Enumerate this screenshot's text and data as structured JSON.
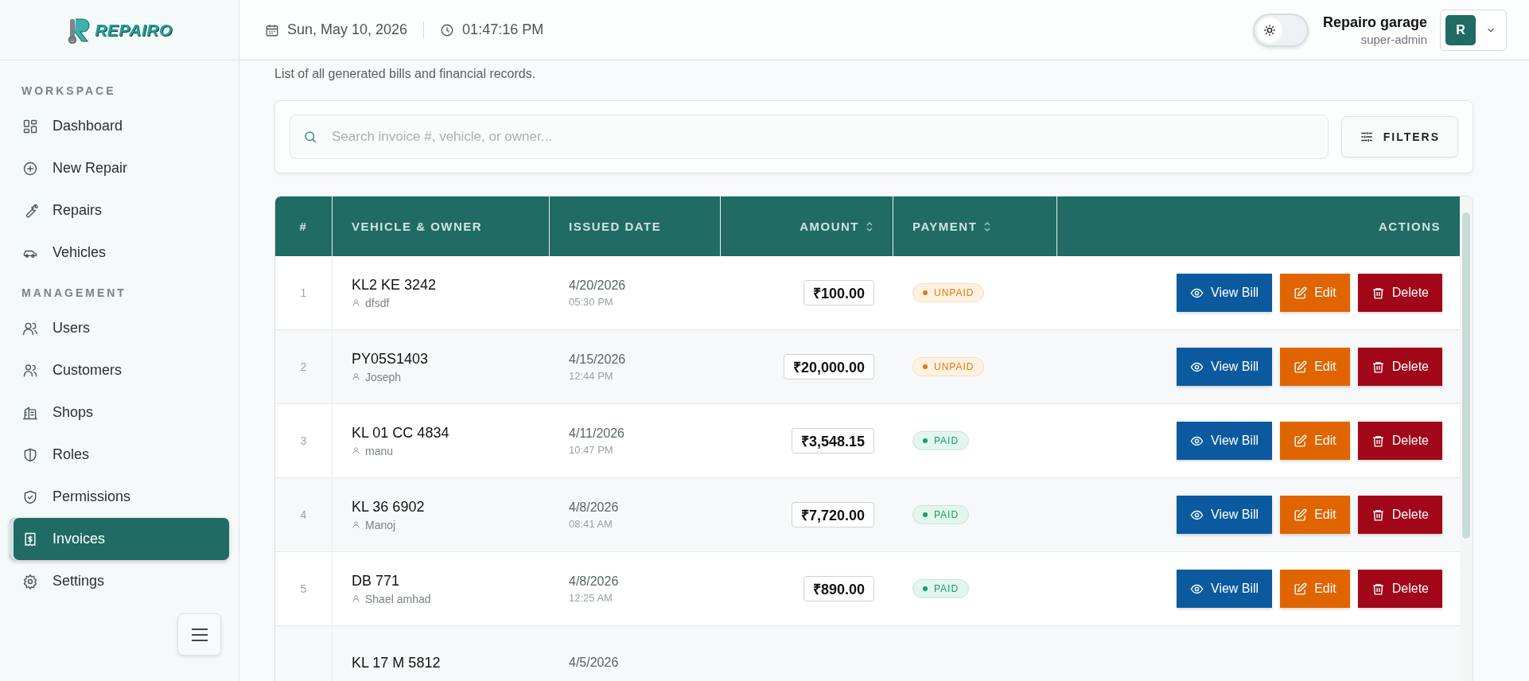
{
  "brand": {
    "name": "REPAIRO"
  },
  "header": {
    "date": "Sun, May 10, 2026",
    "time": "01:47:16 PM",
    "dark_mode": false,
    "user_name": "Repairo garage",
    "user_role": "super-admin",
    "avatar_initial": "R"
  },
  "sidebar": {
    "sections": [
      {
        "title": "WORKSPACE",
        "items": [
          {
            "label": "Dashboard",
            "selected": false
          },
          {
            "label": "New Repair",
            "selected": false
          },
          {
            "label": "Repairs",
            "selected": false
          },
          {
            "label": "Vehicles",
            "selected": false
          }
        ]
      },
      {
        "title": "MANAGEMENT",
        "items": [
          {
            "label": "Users",
            "selected": false
          },
          {
            "label": "Customers",
            "selected": false
          },
          {
            "label": "Shops",
            "selected": false
          },
          {
            "label": "Roles",
            "selected": false
          },
          {
            "label": "Permissions",
            "selected": false
          },
          {
            "label": "Invoices",
            "selected": true
          },
          {
            "label": "Settings",
            "selected": false
          }
        ]
      }
    ]
  },
  "page": {
    "subtitle": "List of all generated bills and financial records."
  },
  "search": {
    "placeholder": "Search invoice #, vehicle, or owner...",
    "filters_label": "FILTERS"
  },
  "table": {
    "columns": [
      {
        "label": "#",
        "sortable": false
      },
      {
        "label": "VEHICLE & OWNER",
        "sortable": false
      },
      {
        "label": "ISSUED DATE",
        "sortable": false
      },
      {
        "label": "AMOUNT",
        "sortable": true
      },
      {
        "label": "PAYMENT",
        "sortable": true
      },
      {
        "label": "ACTIONS",
        "sortable": false
      }
    ],
    "rows": [
      {
        "index": "1",
        "vehicle": "KL2 KE 3242",
        "owner": "dfsdf",
        "date": "4/20/2026",
        "time": "05:30 PM",
        "amount": "₹100.00",
        "payment": {
          "label": "UNPAID",
          "paid": false
        },
        "actions": [
          {
            "label": "View Bill",
            "kind": "view"
          },
          {
            "label": "Edit",
            "kind": "edit"
          },
          {
            "label": "Delete",
            "kind": "delete"
          }
        ]
      },
      {
        "index": "2",
        "vehicle": "PY05S1403",
        "owner": "Joseph",
        "date": "4/15/2026",
        "time": "12:44 PM",
        "amount": "₹20,000.00",
        "payment": {
          "label": "UNPAID",
          "paid": false
        },
        "actions": [
          {
            "label": "View Bill",
            "kind": "view"
          },
          {
            "label": "Edit",
            "kind": "edit"
          },
          {
            "label": "Delete",
            "kind": "delete"
          }
        ]
      },
      {
        "index": "3",
        "vehicle": "KL 01 CC 4834",
        "owner": "manu",
        "date": "4/11/2026",
        "time": "10:47 PM",
        "amount": "₹3,548.15",
        "payment": {
          "label": "PAID",
          "paid": true
        },
        "actions": [
          {
            "label": "View Bill",
            "kind": "view"
          },
          {
            "label": "Edit",
            "kind": "edit"
          },
          {
            "label": "Delete",
            "kind": "delete"
          }
        ]
      },
      {
        "index": "4",
        "vehicle": "KL 36 6902",
        "owner": "Manoj",
        "date": "4/8/2026",
        "time": "08:41 AM",
        "amount": "₹7,720.00",
        "payment": {
          "label": "PAID",
          "paid": true
        },
        "actions": [
          {
            "label": "View Bill",
            "kind": "view"
          },
          {
            "label": "Edit",
            "kind": "edit"
          },
          {
            "label": "Delete",
            "kind": "delete"
          }
        ]
      },
      {
        "index": "5",
        "vehicle": "DB 771",
        "owner": "Shael amhad",
        "date": "4/8/2026",
        "time": "12:25 AM",
        "amount": "₹890.00",
        "payment": {
          "label": "PAID",
          "paid": true
        },
        "actions": [
          {
            "label": "View Bill",
            "kind": "view"
          },
          {
            "label": "Edit",
            "kind": "edit"
          },
          {
            "label": "Delete",
            "kind": "delete"
          }
        ]
      },
      {
        "vehicle": "KL 17 M 5812",
        "date": "4/5/2026"
      }
    ]
  }
}
